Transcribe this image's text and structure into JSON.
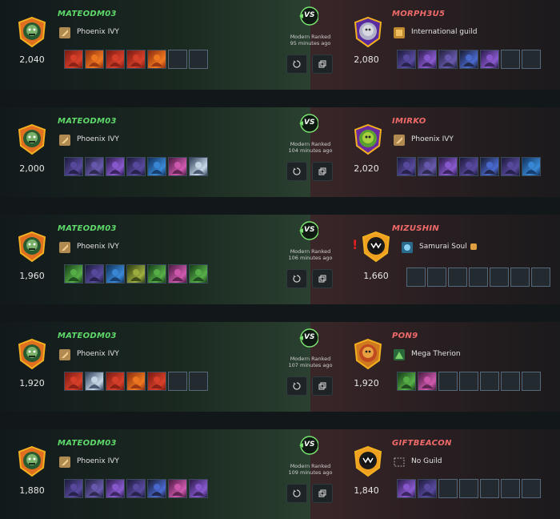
{
  "matches": [
    {
      "left": {
        "name": "MATEODM03",
        "rating": "2,040",
        "guild": "Phoenix IVY",
        "guild_icon": "phoenix-guild-icon",
        "cards": [
          "red-monster",
          "fire-warrior",
          "red-mage",
          "red-archer",
          "fire-dragon",
          "empty",
          "empty"
        ]
      },
      "right": {
        "name": "MORPH3U5",
        "rating": "2,080",
        "guild": "International guild",
        "guild_icon": "international-guild-icon",
        "cards": [
          "dark-knight",
          "purple-summoner",
          "shadow-beast",
          "void-mage",
          "purple-wyrm",
          "empty",
          "empty"
        ]
      },
      "vs": "VS",
      "mode": "Modern Ranked",
      "time": "95 minutes ago"
    },
    {
      "left": {
        "name": "MATEODM03",
        "rating": "2,000",
        "guild": "Phoenix IVY",
        "guild_icon": "phoenix-guild-icon",
        "cards": [
          "dark-summoner",
          "shadow-knight",
          "purple-mage",
          "dark-witch",
          "blue-archer",
          "pink-mage",
          "white-ghost"
        ]
      },
      "right": {
        "name": "IMIRKO",
        "rating": "2,020",
        "guild": "Phoenix IVY",
        "guild_icon": "phoenix-guild-icon",
        "cards": [
          "dark-summoner",
          "shadow-knight",
          "purple-mage",
          "dark-bat",
          "void-beast",
          "dark-witch",
          "blue-ghost"
        ]
      },
      "vs": "VS",
      "mode": "Modern Ranked",
      "time": "104 minutes ago"
    },
    {
      "left": {
        "name": "MATEODM03",
        "rating": "1,960",
        "guild": "Phoenix IVY",
        "guild_icon": "phoenix-guild-icon",
        "cards": [
          "green-summoner",
          "dark-witch",
          "blue-mage",
          "earth-golem",
          "green-dragon",
          "pink-mage",
          "green-archer"
        ]
      },
      "right": {
        "name": "MIZUSHIN",
        "rating": "1,660",
        "guild": "Samurai Soul",
        "guild_icon": "samurai-guild-icon",
        "cards": [
          "empty",
          "empty",
          "empty",
          "empty",
          "empty",
          "empty",
          "empty"
        ],
        "warning": "!"
      },
      "vs": "VS",
      "mode": "Modern Ranked",
      "time": "106 minutes ago"
    },
    {
      "left": {
        "name": "MATEODM03",
        "rating": "1,920",
        "guild": "Phoenix IVY",
        "guild_icon": "phoenix-guild-icon",
        "cards": [
          "red-monster",
          "white-yeti",
          "red-mage",
          "fire-dragon",
          "red-archer",
          "empty",
          "empty"
        ]
      },
      "right": {
        "name": "PON9",
        "rating": "1,920",
        "guild": "Mega Therion",
        "guild_icon": "therion-guild-icon",
        "cards": [
          "green-archer",
          "pink-monster",
          "empty",
          "empty",
          "empty",
          "empty",
          "empty"
        ]
      },
      "vs": "VS",
      "mode": "Modern Ranked",
      "time": "107 minutes ago"
    },
    {
      "left": {
        "name": "MATEODM03",
        "rating": "1,880",
        "guild": "Phoenix IVY",
        "guild_icon": "phoenix-guild-icon",
        "cards": [
          "dark-summoner",
          "shadow-beast",
          "purple-mage",
          "dark-witch",
          "void-knight",
          "pink-mage",
          "purple-wyrm"
        ]
      },
      "right": {
        "name": "GIFTBEACON",
        "rating": "1,840",
        "guild": "No Guild",
        "guild_icon": "no-guild-icon",
        "cards": [
          "purple-summoner",
          "dark-golem",
          "empty",
          "empty",
          "empty",
          "empty",
          "empty"
        ]
      },
      "vs": "VS",
      "mode": "Modern Ranked",
      "time": "109 minutes ago"
    }
  ],
  "colors": {
    "left_name": "#5ed96a",
    "right_name": "#f06a6a",
    "vs_accent": "#7be36f",
    "empty_card": "#232b30"
  }
}
